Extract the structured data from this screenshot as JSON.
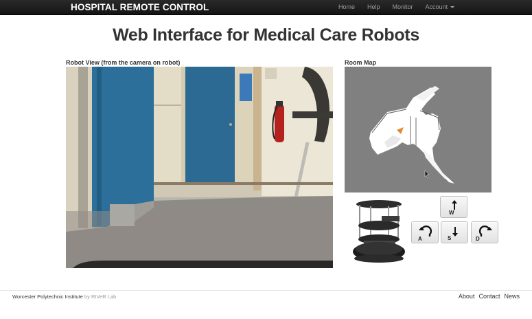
{
  "navbar": {
    "brand": "HOSPITAL REMOTE CONTROL",
    "links": [
      "Home",
      "Help",
      "Monitor",
      "Account"
    ]
  },
  "page_title": "Web Interface for Medical Care Robots",
  "robot_view": {
    "label": "Robot View (from the camera on robot)"
  },
  "room_map": {
    "label": "Room Map"
  },
  "controls": {
    "forward_key": "W",
    "left_key": "A",
    "back_key": "S",
    "right_key": "D"
  },
  "footer": {
    "org": "Worcester Polytechnic Institute",
    "by": "by",
    "lab": "RIVeR Lab",
    "links": [
      "About",
      "Contact",
      "News"
    ]
  },
  "colors": {
    "navbar": "#1b1b1b",
    "map_unknown": "#808080",
    "map_free": "#ffffff"
  }
}
